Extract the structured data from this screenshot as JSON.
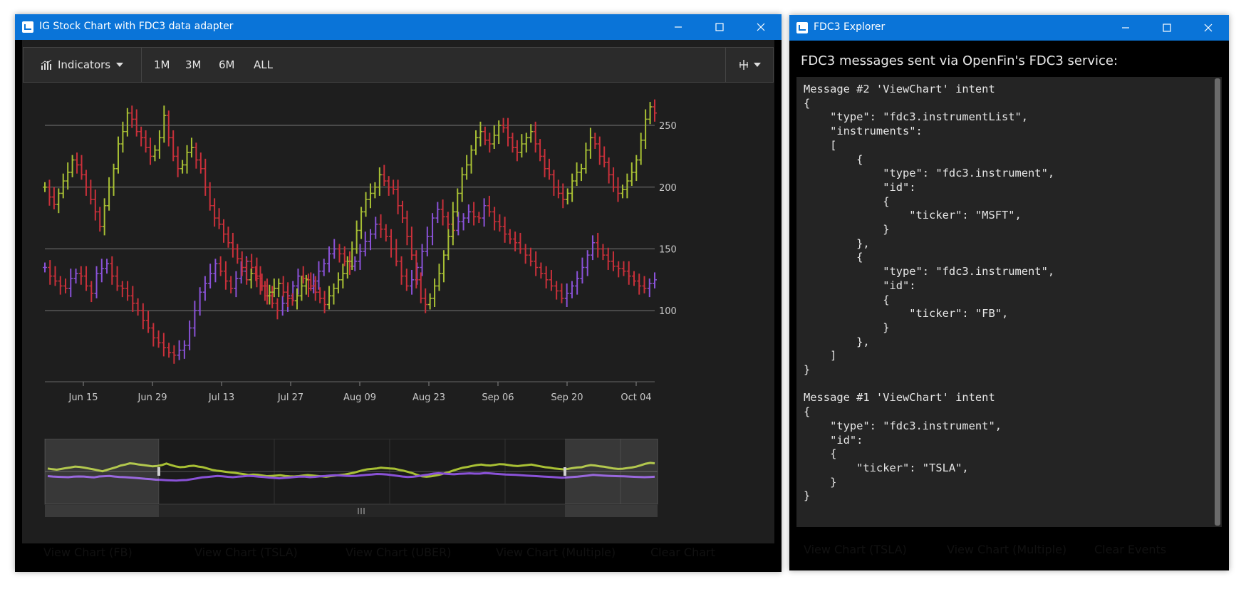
{
  "chart_window": {
    "title": "IG Stock Chart with FDC3 data adapter",
    "toolbar": {
      "indicators_label": "Indicators",
      "ranges": [
        "1M",
        "3M",
        "6M",
        "ALL"
      ]
    },
    "buttons": [
      {
        "label": "View Chart (FB)",
        "color": "#5aa2f5"
      },
      {
        "label": "View Chart (TSLA)",
        "color": "#5aa2f5"
      },
      {
        "label": "View Chart (UBER)",
        "color": "#5aa2f5"
      },
      {
        "label": "View Chart (Multiple)",
        "color": "#8a52d8"
      },
      {
        "label": "Clear Chart",
        "color": "#2bd24a"
      }
    ]
  },
  "explorer_window": {
    "title": "FDC3 Explorer",
    "heading": "FDC3 messages sent via OpenFin's FDC3 service:",
    "code_lines": [
      "Message #2 'ViewChart' intent",
      "{",
      "    \"type\": \"fdc3.instrumentList\",",
      "    \"instruments\":",
      "    [",
      "        {",
      "            \"type\": \"fdc3.instrument\",",
      "            \"id\":",
      "            {",
      "                \"ticker\": \"MSFT\",",
      "            }",
      "        },",
      "        {",
      "            \"type\": \"fdc3.instrument\",",
      "            \"id\":",
      "            {",
      "                \"ticker\": \"FB\",",
      "            }",
      "        },",
      "    ]",
      "}",
      "",
      "Message #1 'ViewChart' intent",
      "{",
      "    \"type\": \"fdc3.instrument\",",
      "    \"id\":",
      "    {",
      "        \"ticker\": \"TSLA\",",
      "    }",
      "}"
    ],
    "buttons": [
      {
        "label": "View Chart (TSLA)",
        "color": "#5aa2f5"
      },
      {
        "label": "View Chart (Multiple)",
        "color": "#8a52d8"
      },
      {
        "label": "Clear Events",
        "color": "#2bd24a"
      }
    ]
  },
  "colors": {
    "titlebar": "#0a74d8",
    "up": "#a8c034",
    "down": "#c9303a",
    "series2": "#8a52d8"
  },
  "chart_data": {
    "type": "line",
    "x_ticks": [
      "Jun 15",
      "Jun 29",
      "Jul 13",
      "Jul 27",
      "Aug 09",
      "Aug 23",
      "Sep 06",
      "Sep 20",
      "Oct 04"
    ],
    "y_ticks": [
      100,
      150,
      200,
      250
    ],
    "ylim": [
      54,
      280
    ],
    "series": [
      {
        "values": [
          200,
          192,
          186,
          195,
          205,
          212,
          222,
          218,
          210,
          200,
          190,
          180,
          168,
          185,
          200,
          215,
          235,
          245,
          260,
          255,
          245,
          240,
          232,
          225,
          230,
          240,
          258,
          240,
          225,
          215,
          218,
          228,
          232,
          222,
          215,
          200,
          185,
          175,
          170,
          162,
          155,
          150,
          142,
          135,
          125,
          130,
          128,
          120,
          112,
          115,
          118,
          122,
          115,
          110,
          108,
          112,
          120,
          125,
          120,
          115,
          110,
          105,
          112,
          118,
          125,
          130,
          140,
          150,
          165,
          180,
          190,
          195,
          200,
          210,
          205,
          200,
          198,
          185,
          175,
          160,
          145,
          125,
          110,
          105,
          110,
          120,
          130,
          145,
          160,
          180,
          195,
          210,
          218,
          230,
          240,
          245,
          238,
          235,
          242,
          250,
          248,
          240,
          232,
          228,
          235,
          240,
          245,
          235,
          225,
          215,
          210,
          200,
          195,
          190,
          195,
          205,
          212,
          215,
          230,
          240,
          235,
          225,
          220,
          210,
          200,
          195,
          198,
          205,
          212,
          222,
          238,
          255,
          265,
          260
        ]
      },
      {
        "values": [
          135,
          128,
          124,
          120,
          118,
          126,
          130,
          128,
          120,
          114,
          130,
          134,
          138,
          128,
          120,
          118,
          112,
          106,
          100,
          92,
          86,
          78,
          74,
          70,
          66,
          64,
          68,
          72,
          86,
          100,
          115,
          122,
          130,
          138,
          132,
          124,
          118,
          126,
          132,
          140,
          135,
          126,
          120,
          112,
          106,
          100,
          106,
          112,
          120,
          128,
          126,
          118,
          124,
          132,
          138,
          146,
          150,
          146,
          140,
          136,
          140,
          148,
          156,
          162,
          170,
          166,
          160,
          150,
          140,
          128,
          120,
          125,
          135,
          148,
          160,
          175,
          182,
          176,
          170,
          165,
          172,
          175,
          180,
          176,
          175,
          185,
          180,
          172,
          168,
          162,
          158,
          155,
          150,
          145,
          140,
          135,
          130,
          125,
          120,
          116,
          110,
          114,
          120,
          126,
          135,
          145,
          155,
          150,
          145,
          140,
          136,
          134,
          132,
          128,
          124,
          120,
          118,
          122,
          125
        ]
      }
    ]
  }
}
